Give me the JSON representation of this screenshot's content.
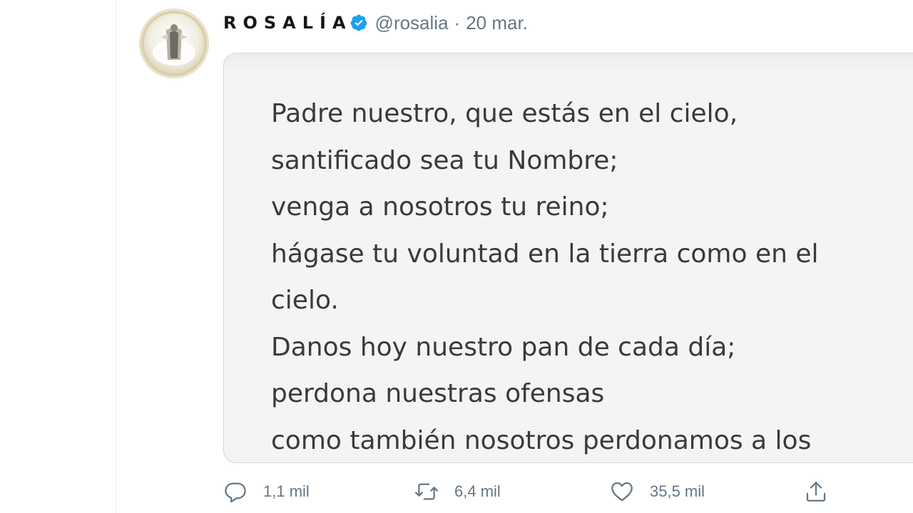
{
  "tweet": {
    "display_name": "ROSALÍA",
    "handle": "@rosalia",
    "separator": "·",
    "date": "20 mar.",
    "verified": true,
    "media": {
      "lines": [
        "Padre nuestro, que estás en el cielo,",
        "santificado sea tu Nombre;",
        "venga a nosotros tu reino;",
        "hágase tu voluntad en la tierra como en el",
        "cielo.",
        "Danos hoy nuestro pan de cada día;",
        "perdona nuestras ofensas",
        "como también nosotros perdonamos a los"
      ]
    },
    "actions": {
      "reply_count": "1,1 mil",
      "retweet_count": "6,4 mil",
      "like_count": "35,5 mil"
    }
  },
  "colors": {
    "verified": "#1da1f2",
    "muted": "#657786",
    "text": "#14171a",
    "media_bg": "#f4f4f2"
  },
  "icons": {
    "reply": "reply-icon",
    "retweet": "retweet-icon",
    "like": "heart-icon",
    "share": "share-icon",
    "verified": "verified-badge-icon"
  }
}
